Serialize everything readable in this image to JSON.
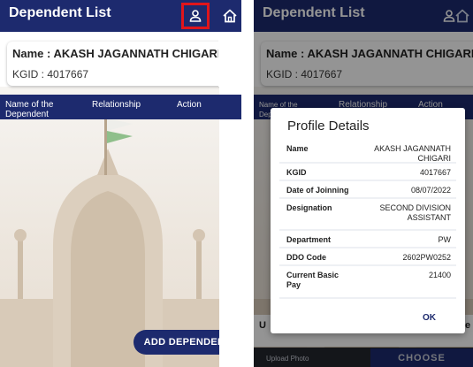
{
  "left": {
    "title": "Dependent List",
    "name_line": "Name : AKASH JAGANNATH CHIGARI",
    "kgid_line": "KGID : 4017667",
    "columns": [
      "Name of the Dependent",
      "Relationship",
      "Action"
    ],
    "add_button": "ADD DEPENDENT"
  },
  "right": {
    "title": "Dependent List",
    "name_line": "Name : AKASH JAGANNATH CHIGARI",
    "kgid_line": "KGID : 4017667",
    "columns": [
      "Name of the Dependent",
      "Relationship",
      "Action"
    ],
    "dialog": {
      "title": "Profile Details",
      "rows": [
        {
          "label": "Name",
          "value": "AKASH JAGANNATH CHIGARI"
        },
        {
          "label": "KGID",
          "value": "4017667"
        },
        {
          "label": "Date of Joinning",
          "value": "08/07/2022"
        },
        {
          "label": "Designation",
          "value": "SECOND DIVISION ASSISTANT"
        },
        {
          "label": "Department",
          "value": "PW"
        },
        {
          "label": "DDO Code",
          "value": "2602PW0252"
        },
        {
          "label": "Current Basic Pay",
          "value": "21400"
        }
      ],
      "ok": "OK"
    },
    "peek_left": "U",
    "peek_right": "e",
    "upload_label": "Upload Photo",
    "choose_button": "CHOOSE"
  },
  "colors": {
    "navy": "#1d2a6e",
    "highlight": "#e0151b"
  },
  "icons": {
    "profile": "person-icon",
    "home": "home-icon"
  }
}
